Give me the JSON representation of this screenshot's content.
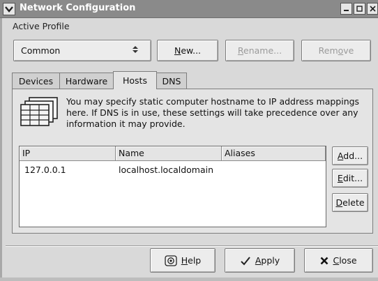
{
  "window": {
    "title": "Network Configuration",
    "controls": {
      "minimize": "▁",
      "maximize": "□",
      "close": "✕"
    }
  },
  "profile": {
    "label": "Active Profile",
    "selected": "Common",
    "new_label_pre": "",
    "new_label_u": "N",
    "new_label_post": "ew...",
    "rename_label_pre": "",
    "rename_label_u": "R",
    "rename_label_post": "ename...",
    "remove_label_pre": "Rem",
    "remove_label_u": "o",
    "remove_label_post": "ve"
  },
  "tabs": [
    {
      "label": "Devices"
    },
    {
      "label": "Hardware"
    },
    {
      "label": "Hosts"
    },
    {
      "label": "DNS"
    }
  ],
  "hosts": {
    "info_text": "You may specify static computer hostname to IP address mappings here.  If DNS is in use, these settings will take precedence over any information it may provide.",
    "columns": [
      "IP",
      "Name",
      "Aliases"
    ],
    "rows": [
      {
        "ip": "127.0.0.1",
        "name": "localhost.localdomain",
        "aliases": ""
      }
    ],
    "add_u": "A",
    "add_post": "dd...",
    "edit_u": "E",
    "edit_post": "dit...",
    "delete_u": "D",
    "delete_post": "elete"
  },
  "footer": {
    "help_u": "H",
    "help_post": "elp",
    "apply_u": "A",
    "apply_post": "pply",
    "close_u": "C",
    "close_post": "lose"
  },
  "colors": {
    "titlebar": "#8a8a8a",
    "window_bg": "#d9d9d9",
    "panel_bg": "#e4e4e4"
  },
  "icons": {
    "window_menu": "chevron-down-icon",
    "info": "hosts-table-icon",
    "help": "help-icon",
    "apply": "checkmark-icon",
    "close": "close-x-icon"
  }
}
